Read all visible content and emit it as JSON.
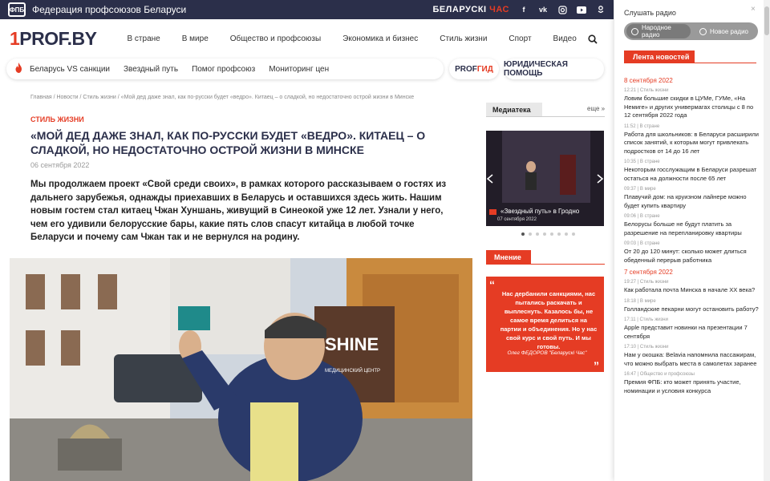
{
  "topbar": {
    "logo_text": "ФПБ",
    "title": "Федерация профсоюзов Беларуси",
    "radio_brand_a": "БЕЛАРУСКІ",
    "radio_brand_b": "ЧАС",
    "social": [
      "f",
      "vk",
      "ig",
      "yt",
      "od"
    ]
  },
  "header": {
    "logo_a": "1",
    "logo_b": "PROF.BY",
    "nav": [
      "В стране",
      "В мире",
      "Общество и профсоюзы",
      "Экономика и бизнес",
      "Стиль жизни",
      "Спорт",
      "Видео"
    ]
  },
  "subnav": {
    "items": [
      "Беларусь VS санкции",
      "Звездный путь",
      "Помог профсоюз",
      "Мониторинг цен"
    ],
    "gid_a": "PROF",
    "gid_b": "ГИД",
    "law": "ЮРИДИЧЕСКАЯ ПОМОЩЬ"
  },
  "article": {
    "breadcrumb": "Главная / Новости / Стиль жизни / «Мой дед даже знал, как по-русски будет «ведро». Китаец – о сладкой, но недостаточно острой жизни в Минске",
    "section": "СТИЛЬ ЖИЗНИ",
    "title": "«МОЙ ДЕД ДАЖЕ ЗНАЛ, КАК ПО-РУССКИ БУДЕТ «ВЕДРО». КИТАЕЦ – О СЛАДКОЙ, НО НЕДОСТАТОЧНО ОСТРОЙ ЖИЗНИ В МИНСКЕ",
    "date": "06 сентября 2022",
    "lead": "Мы продолжаем проект «Свой среди своих», в рамках которого рассказываем о гостях из дальнего зарубежья, однажды приехавших в Беларусь и оставшихся здесь жить. Нашим новым гостем стал китаец Чжан Хуншань, живущий в Синеокой уже 12 лет. Узнали у него, чем его удивили белорусские бары, какие пять слов спасут китайца в любой точке Беларуси и почему сам Чжан так и не вернулся на родину.",
    "photo_sign_a": "SHINE",
    "photo_sign_b": "МЕДИЦИНСКИЙ ЦЕНТР"
  },
  "media": {
    "tab": "Медиатека",
    "more": "еще »",
    "card_title": "«Звездный путь» в Гродно",
    "card_date": "07 сентября 2022",
    "dots_total": 8,
    "dots_active": 1
  },
  "opinion": {
    "tab": "Мнение",
    "text": "Нас дербанили санкциями, нас пытались раскачать и выплеснуть. Казалось бы, не самое время делиться на партии и объединения. Но у нас свой курс и свой путь. И мы готовы.",
    "author": "Олег ФЕДОРОВ \"Беларускі Час\""
  },
  "sidebar": {
    "radio_label": "Слушать радио",
    "radio_opt_1": "Народное радио",
    "radio_opt_2": "Новое радио",
    "news_tab": "Лента новостей",
    "feed": [
      {
        "day": "8 сентября 2022"
      },
      {
        "meta": "12:21 | Стиль жизни",
        "title": "Ловим большие скидки в ЦУМе, ГУМе, «На Немиге» и других универмагах столицы с 8 по 12 сентября 2022 года"
      },
      {
        "meta": "11:52 | В стране",
        "title": "Работа для школьников: в Беларуси расширили список занятий, к которым могут привлекать подростков от 14 до 16 лет"
      },
      {
        "meta": "10:35 | В стране",
        "title": "Некоторым госслужащим в Беларуси разрешат остаться на должности после 65 лет"
      },
      {
        "meta": "09:37 | В мире",
        "title": "Плавучий дом: на круизном лайнере можно будет купить квартиру"
      },
      {
        "meta": "09:06 | В стране",
        "title": "Белорусы больше не будут платить за разрешение на перепланировку квартиры"
      },
      {
        "meta": "09:03 | В стране",
        "title": "От 20 до 120 минут: сколько может длиться обеденный перерыв работника"
      },
      {
        "day": "7 сентября 2022"
      },
      {
        "meta": "19:27 | Стиль жизни",
        "title": "Как работала почта Минска в начале XX века?"
      },
      {
        "meta": "18:18 | В мире",
        "title": "Голландские пекарни могут остановить работу?"
      },
      {
        "meta": "17:11 | Стиль жизни",
        "title": "Apple представит новинки на презентации 7 сентября"
      },
      {
        "meta": "17:10 | Стиль жизни",
        "title": "Нам у окошка: Belavia напомнила пассажирам, что можно выбрать места в самолетах заранее"
      },
      {
        "meta": "16:47 | Общество и профсоюзы",
        "title": "Премия ФПБ: кто может принять участие, номинации и условия конкурса"
      }
    ]
  }
}
